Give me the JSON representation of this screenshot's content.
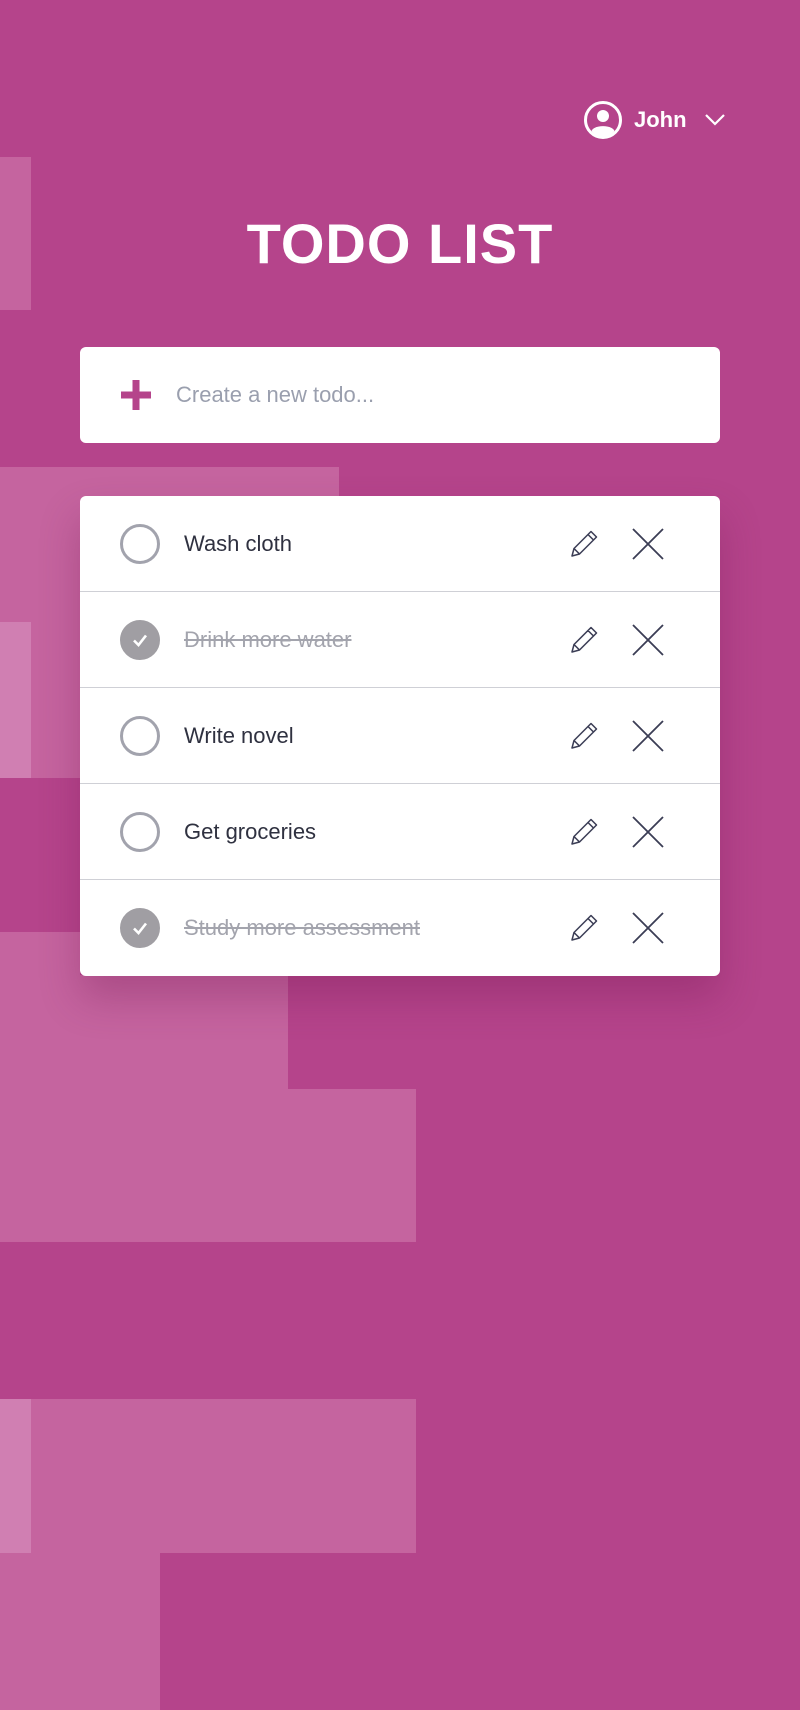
{
  "user": {
    "name": "John"
  },
  "title": "TODO LIST",
  "new_todo": {
    "placeholder": "Create a new todo..."
  },
  "todos": [
    {
      "text": "Wash cloth",
      "completed": false
    },
    {
      "text": "Drink more water",
      "completed": true
    },
    {
      "text": "Write novel",
      "completed": false
    },
    {
      "text": "Get groceries",
      "completed": false
    },
    {
      "text": "Study more assessment",
      "completed": true
    }
  ],
  "icons": {
    "user": "user-circle-icon",
    "chevron": "chevron-down-icon",
    "add": "plus-icon",
    "check": "check-icon",
    "edit": "pencil-icon",
    "delete": "close-icon"
  },
  "colors": {
    "background": "#b5448b",
    "accent": "#b5448b",
    "card": "#ffffff",
    "completed_check": "#a09ea3",
    "text": "#2f3140",
    "muted_text": "#a3a4ad"
  }
}
